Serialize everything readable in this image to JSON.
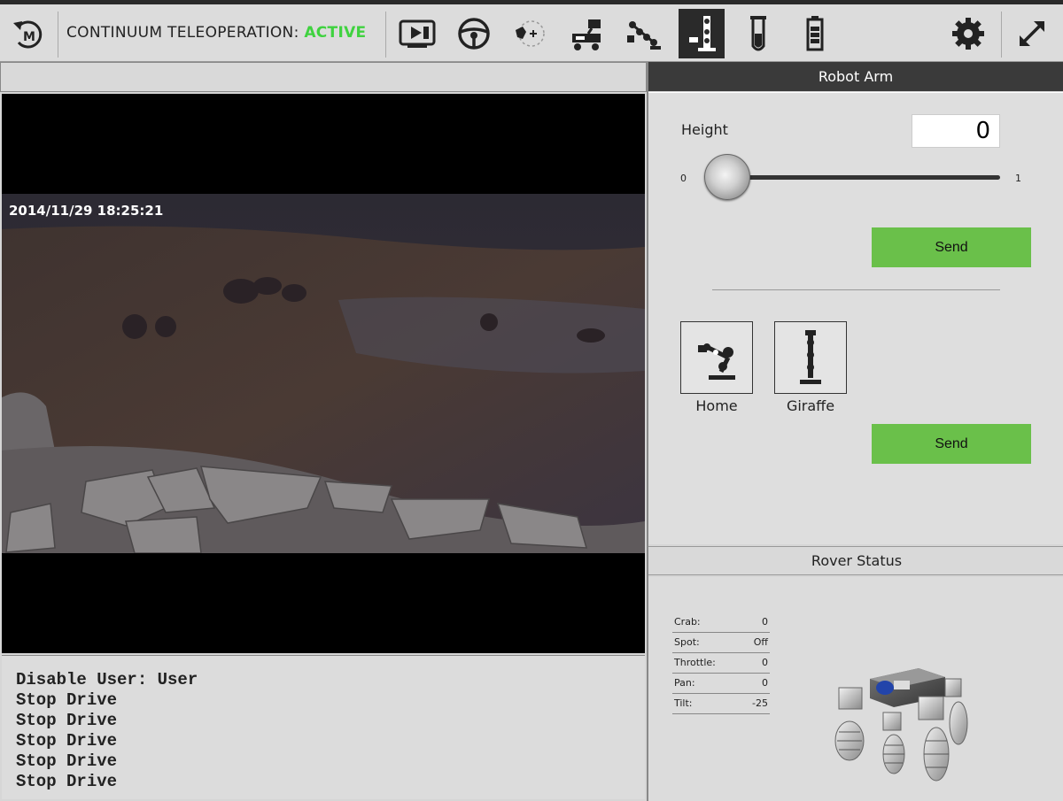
{
  "toolbar": {
    "title_prefix": "CONTINUUM TELEOPERATION:",
    "title_status": "ACTIVE",
    "status_color": "#3fd23f",
    "icons": [
      "menu-back-icon",
      "camera-icon",
      "steering-wheel-icon",
      "rotate-icon",
      "rover-camera-icon",
      "robot-arm-icon",
      "giraffe-arm-icon",
      "test-tube-icon",
      "battery-icon",
      "gear-icon",
      "expand-icon"
    ]
  },
  "video": {
    "timestamp": "2014/11/29 18:25:21"
  },
  "log": {
    "lines": [
      "Disable User: User",
      "Stop Drive",
      "Stop Drive",
      "Stop Drive",
      "Stop Drive",
      "Stop Drive"
    ]
  },
  "robot_arm": {
    "header": "Robot Arm",
    "height_label": "Height",
    "height_value": "0",
    "slider_min": "0",
    "slider_max": "1",
    "slider_value": 0,
    "send_label": "Send",
    "presets": [
      {
        "label": "Home",
        "icon": "home-arm-icon"
      },
      {
        "label": "Giraffe",
        "icon": "giraffe-arm-icon"
      }
    ],
    "send2_label": "Send",
    "accent": "#6ac04a"
  },
  "rover_status": {
    "header": "Rover Status",
    "rows": [
      {
        "label": "Crab:",
        "value": "0"
      },
      {
        "label": "Spot:",
        "value": "Off"
      },
      {
        "label": "Throttle:",
        "value": "0"
      },
      {
        "label": "Pan:",
        "value": "0"
      },
      {
        "label": "Tilt:",
        "value": "-25"
      }
    ]
  }
}
